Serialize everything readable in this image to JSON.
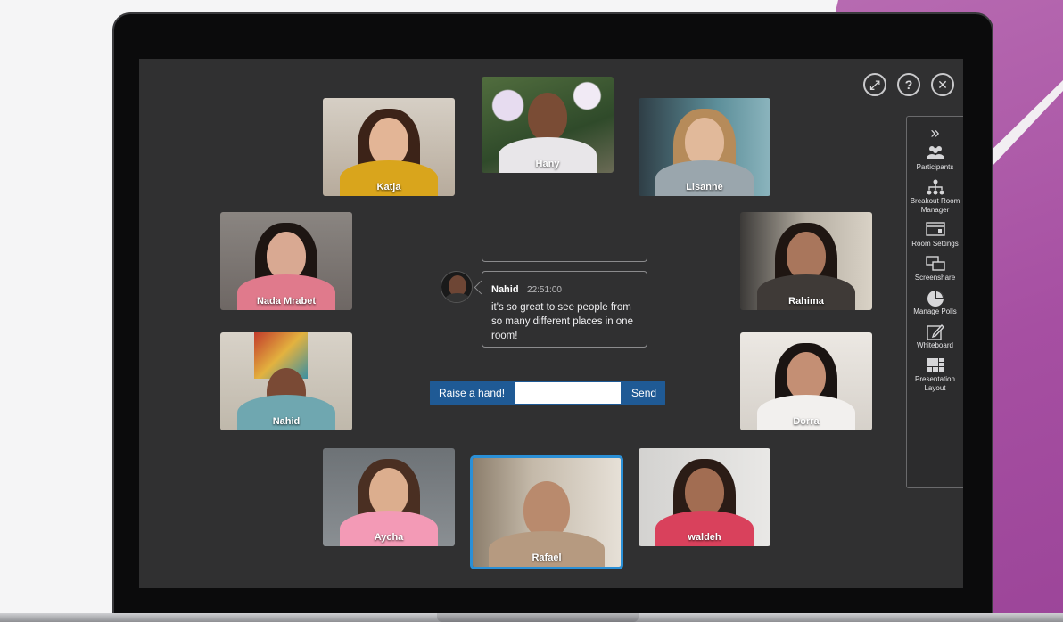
{
  "participants": [
    {
      "name": "Katja"
    },
    {
      "name": "Hany"
    },
    {
      "name": "Lisanne"
    },
    {
      "name": "Nada Mrabet"
    },
    {
      "name": "Rahima"
    },
    {
      "name": "Nahid"
    },
    {
      "name": "Dorra"
    },
    {
      "name": "Aycha"
    },
    {
      "name": "Rafael"
    },
    {
      "name": "waldeh"
    }
  ],
  "top_controls": {
    "fullscreen_icon": "expand-icon",
    "help_icon": "help-icon",
    "close_icon": "close-icon"
  },
  "sidebar": {
    "collapse_icon": "chevrons-right-icon",
    "items": [
      {
        "label": "Participants",
        "icon": "people-icon"
      },
      {
        "label": "Breakout Room Manager",
        "icon": "hierarchy-icon"
      },
      {
        "label": "Room Settings",
        "icon": "window-icon"
      },
      {
        "label": "Screenshare",
        "icon": "screens-icon"
      },
      {
        "label": "Manage Polls",
        "icon": "pie-icon"
      },
      {
        "label": "Whiteboard",
        "icon": "pencil-icon"
      },
      {
        "label": "Presentation Layout",
        "icon": "layout-icon"
      }
    ]
  },
  "chat": {
    "author": "Nahid",
    "time": "22:51:00",
    "message": "it's so great to see people from so many different places in one room!"
  },
  "input_bar": {
    "raise_label": "Raise a hand!",
    "input_value": "",
    "send_label": "Send"
  },
  "colors": {
    "screen_bg": "#303031",
    "accent_blue": "#1f5a95",
    "active_border": "#2a8fd6",
    "brand_purple": "#a64fa2"
  }
}
